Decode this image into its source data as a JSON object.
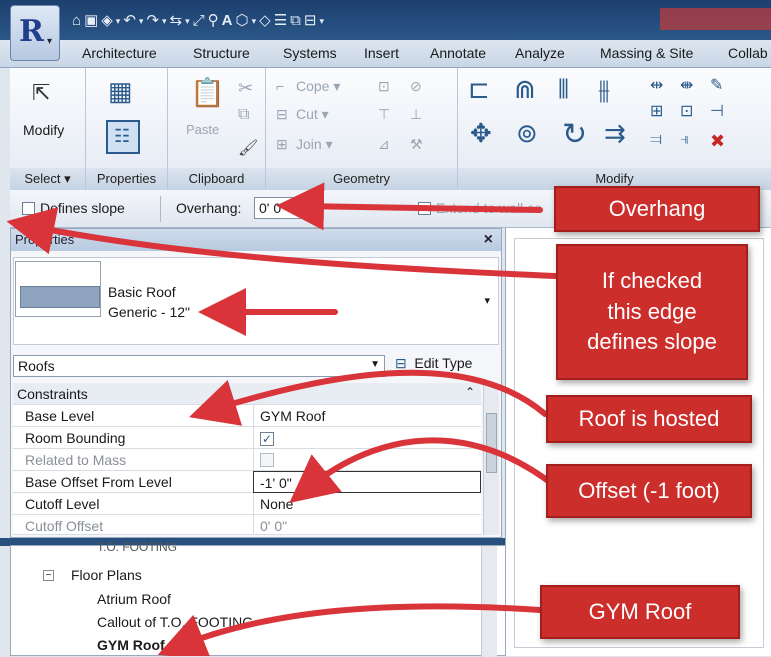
{
  "tabs": [
    "Architecture",
    "Structure",
    "Systems",
    "Insert",
    "Annotate",
    "Analyze",
    "Massing & Site",
    "Collab"
  ],
  "ribbon": {
    "modify_label": "Modify",
    "paste_label": "Paste",
    "cope_label": "Cope",
    "cut_label": "Cut",
    "join_label": "Join",
    "panels": {
      "select": "Select",
      "properties": "Properties",
      "clipboard": "Clipboard",
      "geometry": "Geometry",
      "modify": "Modify"
    }
  },
  "options_bar": {
    "defines_slope_label": "Defines slope",
    "overhang_label": "Overhang:",
    "overhang_value": "0'  0\"",
    "extend_label": "Extend to wall co"
  },
  "properties": {
    "title": "Properties",
    "close": "×",
    "type_name": "Basic Roof",
    "type_sub": "Generic - 12\"",
    "category": "Roofs",
    "edit_type": "Edit Type",
    "section": "Constraints",
    "rows": [
      {
        "key": "Base Level",
        "value": "GYM Roof"
      },
      {
        "key": "Room Bounding",
        "value": ""
      },
      {
        "key": "Related to Mass",
        "value": ""
      },
      {
        "key": "Base Offset From Level",
        "value": "-1'  0\""
      },
      {
        "key": "Cutoff Level",
        "value": "None"
      },
      {
        "key": "Cutoff Offset",
        "value": "0'  0\""
      }
    ]
  },
  "browser": {
    "partial_top": "T.O. FOOTING",
    "floor_plans": "Floor Plans",
    "items": [
      "Atrium Roof",
      "Callout of T.O. FOOTING",
      "GYM Roof"
    ]
  },
  "callouts": {
    "overhang": "Overhang",
    "defines_slope": "If checked\nthis edge\ndefines slope",
    "hosted": "Roof is hosted",
    "offset": "Offset (-1 foot)",
    "gym": "GYM Roof"
  },
  "colors": {
    "callout": "#cc2e2c",
    "arrow": "#d8343a",
    "title_bar": "#1c3f6e"
  }
}
